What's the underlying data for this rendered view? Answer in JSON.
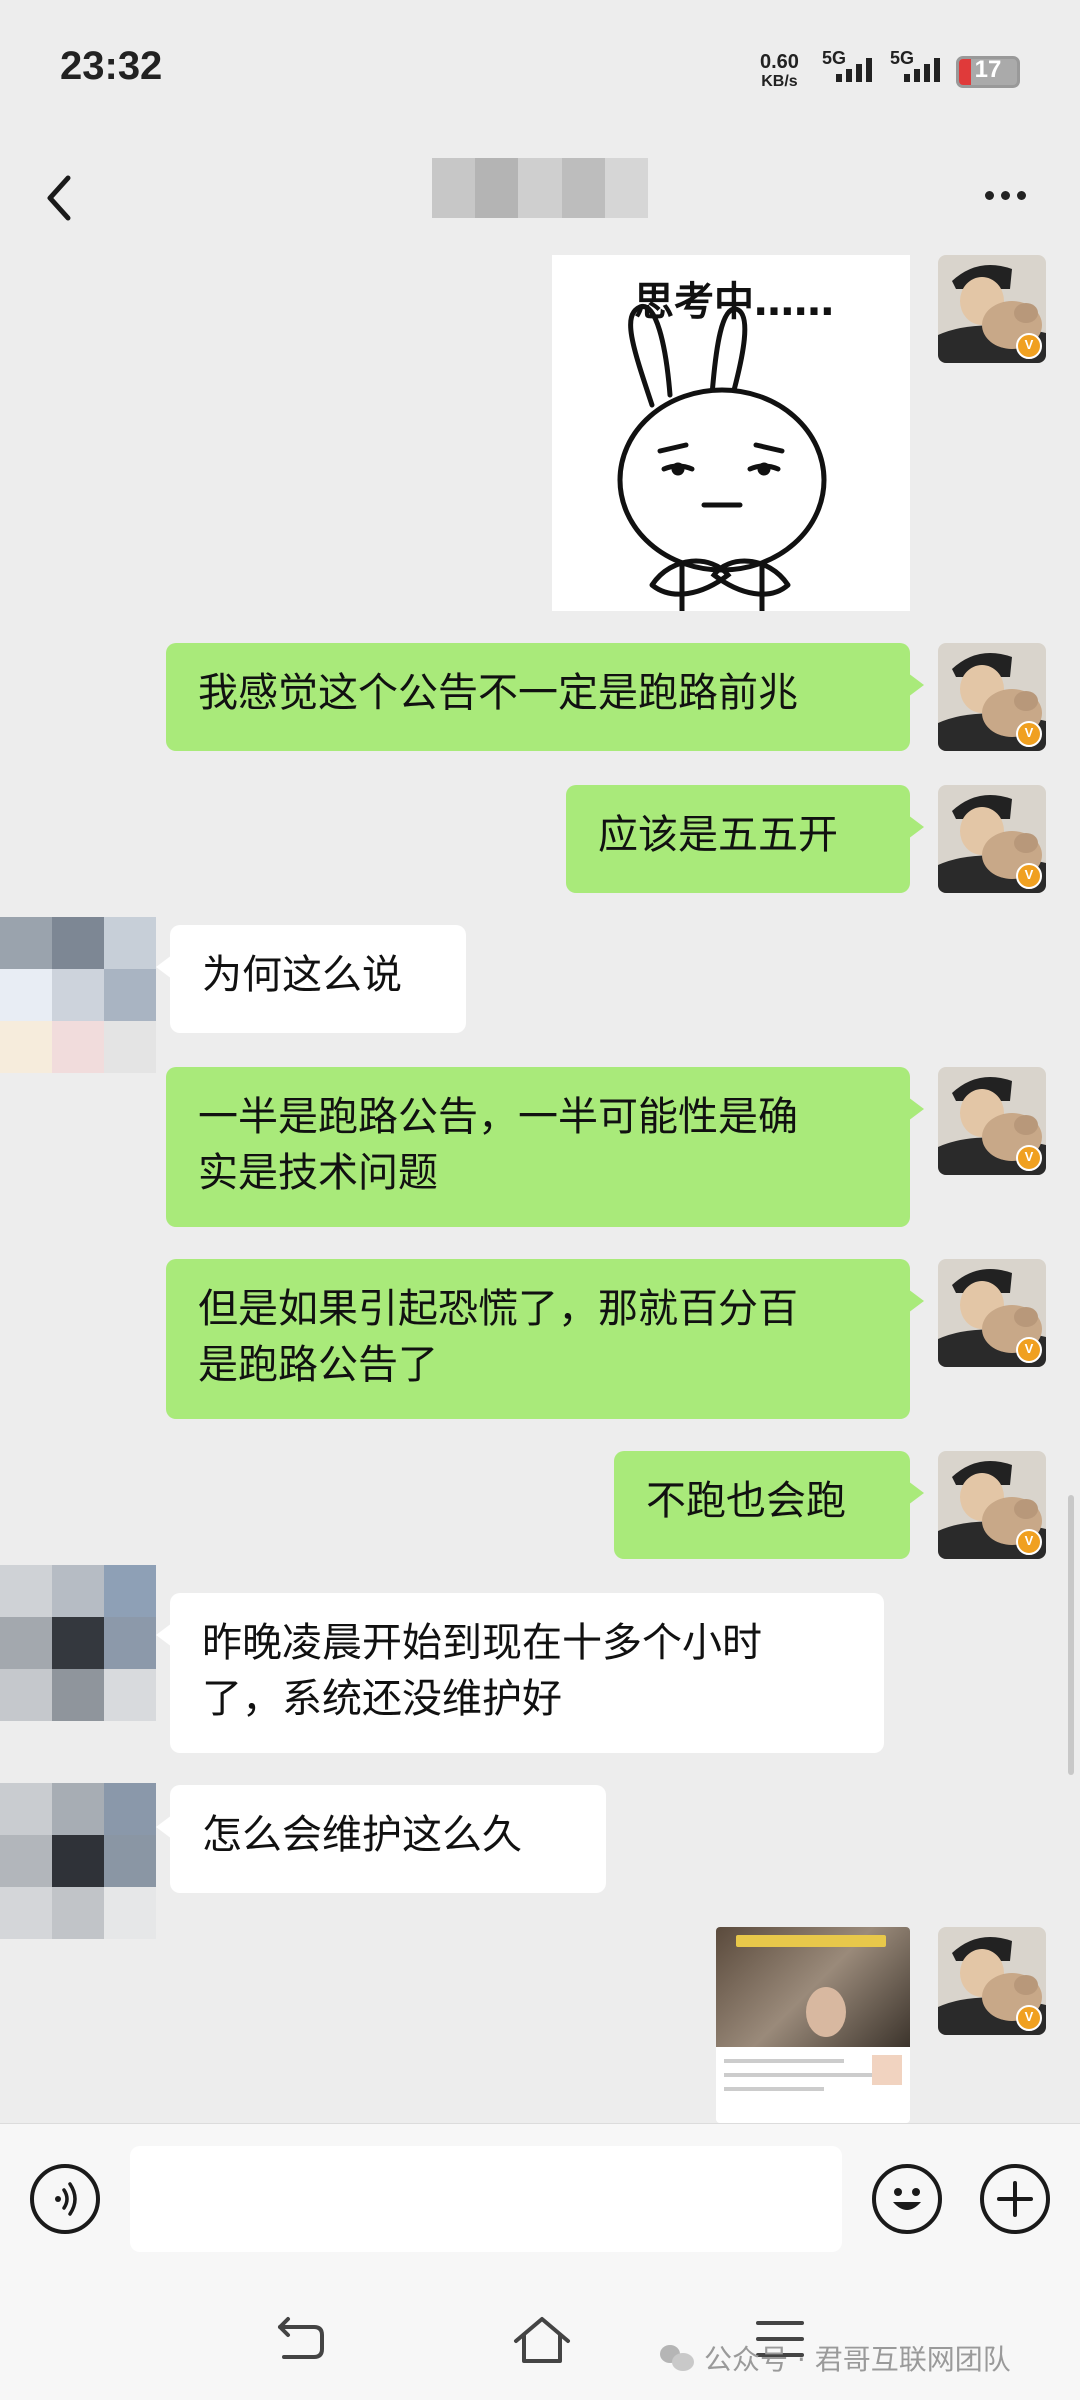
{
  "status_bar": {
    "time": "23:32",
    "net_speed_value": "0.60",
    "net_speed_unit": "KB/s",
    "signal1_label": "5G",
    "signal2_label": "5G",
    "battery_level": "17"
  },
  "nav": {
    "back_icon": "chevron-left-icon",
    "more_icon": "ellipsis-icon"
  },
  "messages": [
    {
      "side": "right",
      "type": "sticker",
      "text": "思考中……"
    },
    {
      "side": "right",
      "type": "text",
      "text": "我感觉这个公告不一定是跑路前兆"
    },
    {
      "side": "right",
      "type": "text",
      "text": "应该是五五开"
    },
    {
      "side": "left",
      "type": "text",
      "text": "为何这么说"
    },
    {
      "side": "right",
      "type": "text",
      "line1": "一半是跑路公告，一半可能性是确",
      "line2": "实是技术问题"
    },
    {
      "side": "right",
      "type": "text",
      "line1": "但是如果引起恐慌了，那就百分百",
      "line2": "是跑路公告了"
    },
    {
      "side": "right",
      "type": "text",
      "text": "不跑也会跑"
    },
    {
      "side": "left",
      "type": "text",
      "line1": "昨晚凌晨开始到现在十多个小时",
      "line2": "了，系统还没维护好"
    },
    {
      "side": "left",
      "type": "text",
      "text": "怎么会维护这么久"
    },
    {
      "side": "right",
      "type": "video",
      "text": ""
    }
  ],
  "input_bar": {
    "input_value": "",
    "voice_icon": "voice-icon",
    "emoji_icon": "emoji-icon",
    "plus_icon": "plus-icon"
  },
  "watermark": {
    "text": "公众号 · 君哥互联网团队"
  },
  "colors": {
    "sent_bubble": "#a9ea7a",
    "received_bubble": "#ffffff",
    "background": "#ededed"
  }
}
